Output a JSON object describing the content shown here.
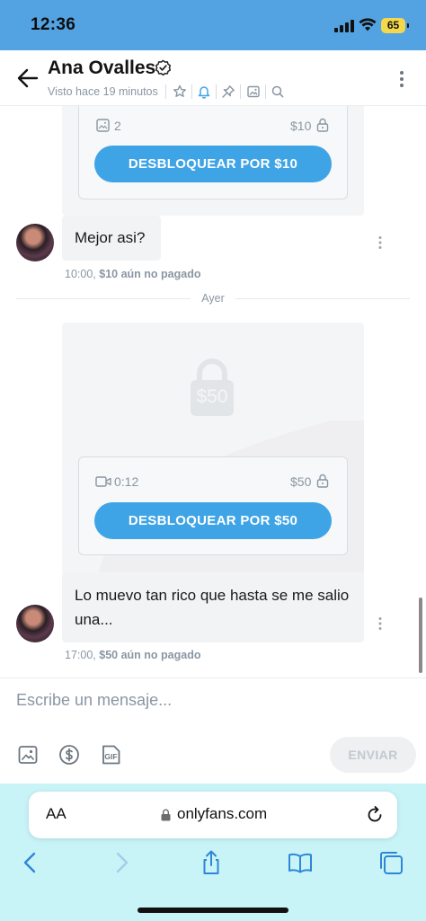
{
  "status_bar": {
    "time": "12:36",
    "battery": "65"
  },
  "header": {
    "name": "Ana Ovalles",
    "seen": "Visto hace 19 minutos",
    "icons": [
      "star-icon",
      "bell-icon",
      "pin-icon",
      "image-icon",
      "search-icon"
    ]
  },
  "messages": [
    {
      "ppv": {
        "media_count": "2",
        "price": "$10",
        "button": "DESBLOQUEAR POR $10"
      },
      "text": "Mejor asi?",
      "time": "10:00,",
      "status": "$10 aún no pagado"
    },
    {
      "ppv": {
        "cover_price": "$50",
        "duration": "0:12",
        "price": "$50",
        "button": "DESBLOQUEAR POR $50"
      },
      "text": "Lo muevo tan rico que hasta se me salio una...",
      "time": "17:00,",
      "status": "$50 aún no pagado"
    }
  ],
  "divider": "Ayer",
  "composer": {
    "placeholder": "Escribe un mensaje...",
    "send": "ENVIAR"
  },
  "safari": {
    "aa": "AA",
    "url": "onlyfans.com"
  },
  "colors": {
    "accent": "#3fa4e6",
    "status_bar": "#53a3e2",
    "safari_bar": "#c8f4f8"
  }
}
